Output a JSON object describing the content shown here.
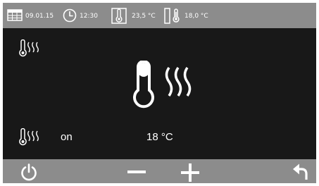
{
  "status_bar": {
    "date": "09.01.15",
    "time": "12:30",
    "outdoor_temperature": "23,5 °C",
    "indoor_temperature": "18,0 °C",
    "icons": [
      "calendar-icon",
      "clock-icon",
      "thermometer-icon",
      "window-thermometer-icon"
    ]
  },
  "main": {
    "corner_icon": "thermometer-heat-icon",
    "center_icon": "thermometer-heat-icon",
    "heating_state": "on",
    "setpoint": "18 °C"
  },
  "bottom_bar": {
    "icons": [
      "power-icon",
      "minus-icon",
      "plus-icon",
      "back-arrow-icon"
    ]
  },
  "colors": {
    "bar_background": "#8c8c8c",
    "screen_background": "#181818",
    "foreground": "#ffffff"
  }
}
